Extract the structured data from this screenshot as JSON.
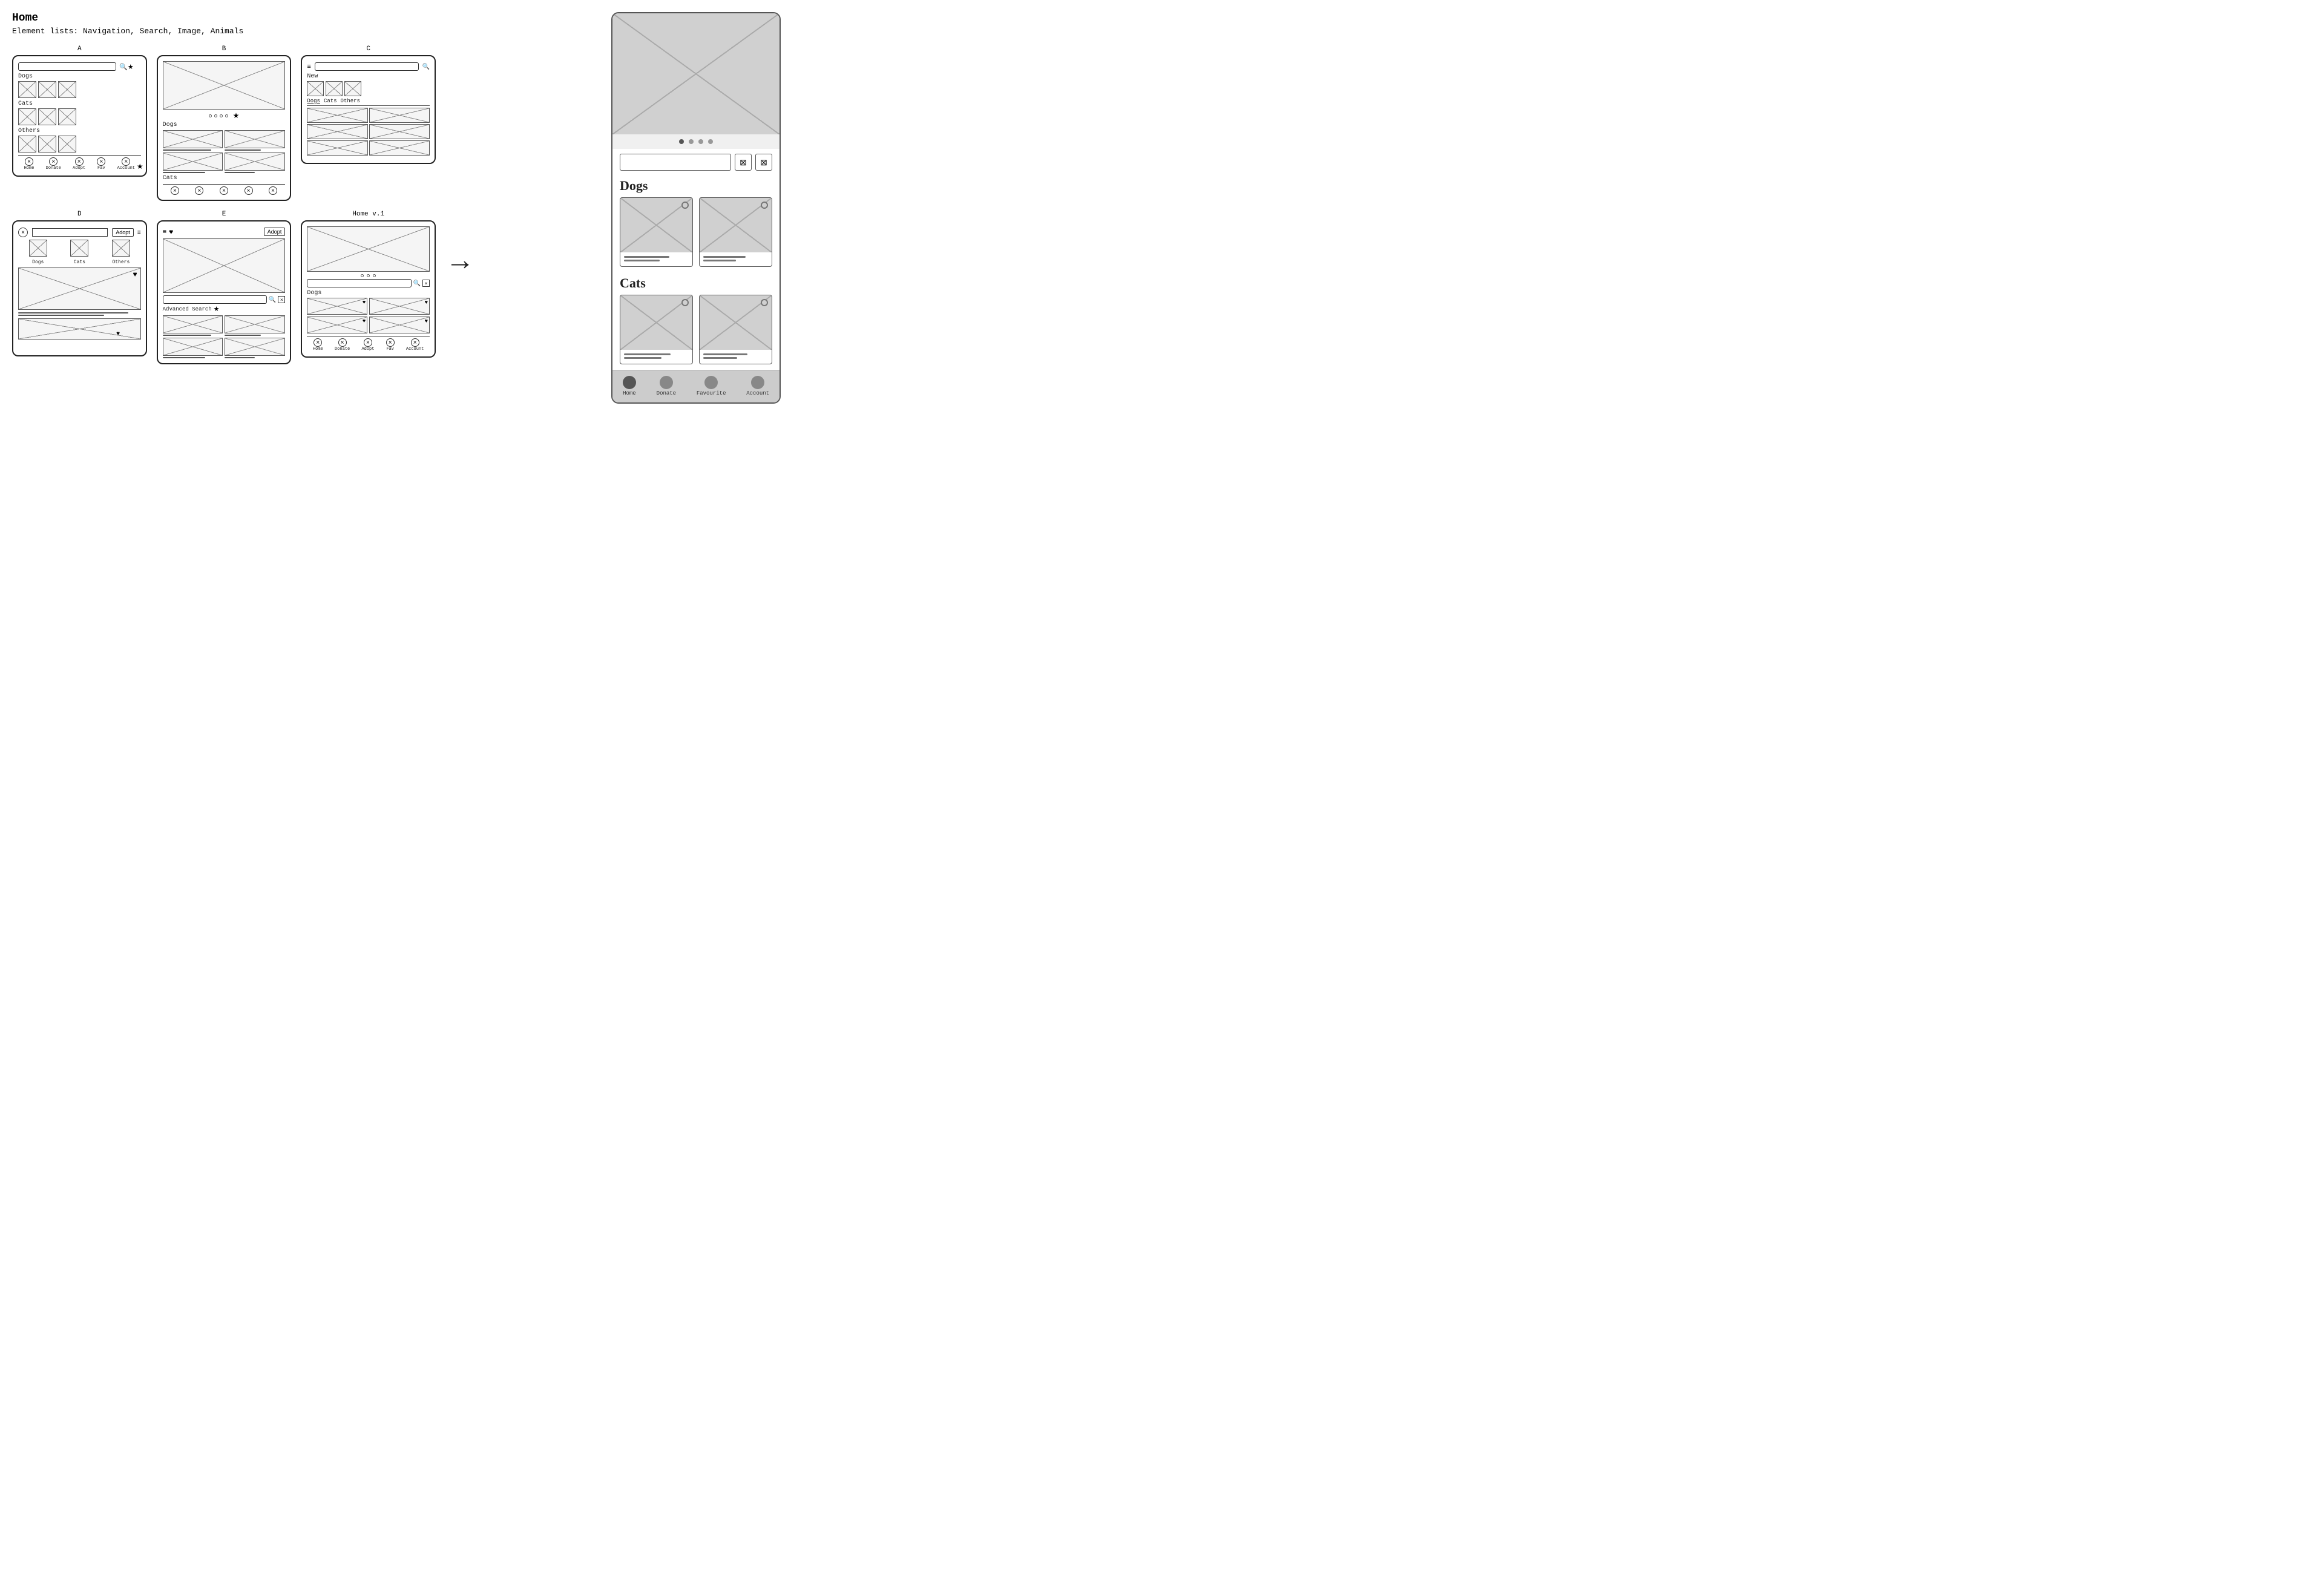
{
  "page": {
    "title": "Home",
    "subtitle": "Element lists: Navigation, Search, Image, Animals"
  },
  "sketches": {
    "top_row": [
      {
        "label": "A",
        "type": "list_view"
      },
      {
        "label": "B",
        "type": "carousel_view"
      },
      {
        "label": "C",
        "type": "tabbed_view"
      }
    ],
    "bottom_row": [
      {
        "label": "D",
        "type": "simple_view"
      },
      {
        "label": "E",
        "type": "advanced_search"
      },
      {
        "label": "Home v.1",
        "type": "final_sketch"
      }
    ]
  },
  "arrow": "→",
  "mockup": {
    "dots": [
      "active",
      "inactive",
      "inactive",
      "inactive"
    ],
    "search_placeholder": "",
    "sections": [
      {
        "title": "Dogs",
        "cards": [
          {
            "has_dot": true
          },
          {
            "has_dot": true
          }
        ]
      },
      {
        "title": "Cats",
        "cards": [
          {
            "has_dot": true
          },
          {
            "has_dot": true
          }
        ]
      }
    ],
    "bottom_nav": [
      {
        "label": "Home",
        "active": true
      },
      {
        "label": "Donate",
        "active": false
      },
      {
        "label": "Favourite",
        "active": false
      },
      {
        "label": "Account",
        "active": false
      }
    ]
  },
  "section_labels": {
    "dogs": "Dogs",
    "cats": "Cats",
    "others": "Others",
    "new": "New"
  },
  "nav_labels": {
    "home": "Home",
    "donate": "Donate",
    "adopt": "Adopt",
    "fav": "Fav",
    "account": "Account"
  }
}
